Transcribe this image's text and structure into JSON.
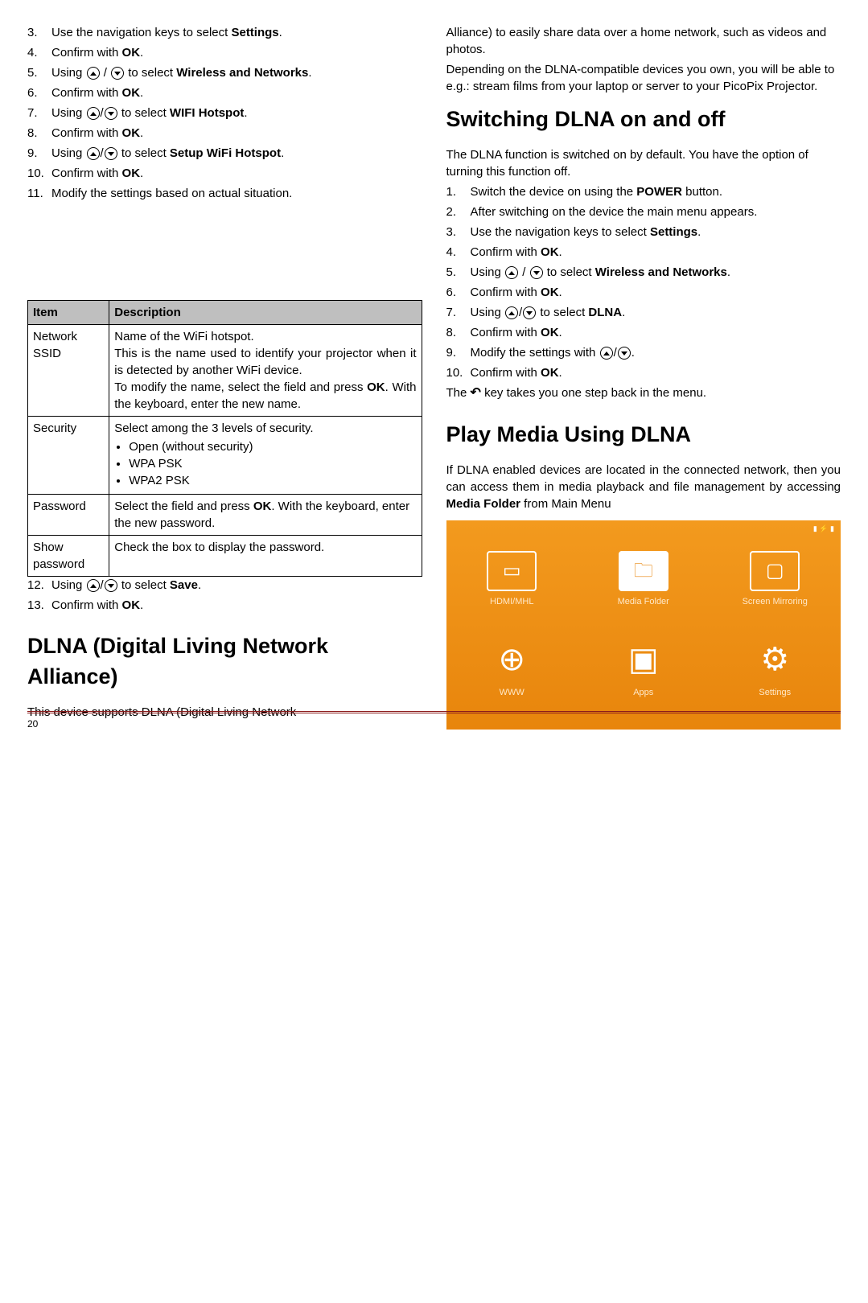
{
  "left": {
    "steps_a": [
      {
        "n": "3.",
        "t_pre": "Use the navigation keys to select ",
        "b": "Settings",
        "t_post": "."
      },
      {
        "n": "4.",
        "t_pre": "Confirm with ",
        "b": "OK",
        "t_post": "."
      },
      {
        "n": "5.",
        "t_pre": "Using ",
        "icons": "updown_spaced",
        "t_mid": " to select ",
        "b": "Wireless and Networks",
        "t_post": "."
      },
      {
        "n": "6.",
        "t_pre": "Confirm with ",
        "b": "OK",
        "t_post": "."
      },
      {
        "n": "7.",
        "t_pre": "Using ",
        "icons": "updown",
        "t_mid": " to select ",
        "b": "WIFI Hotspot",
        "t_post": "."
      },
      {
        "n": "8.",
        "t_pre": "Confirm with ",
        "b": "OK",
        "t_post": "."
      },
      {
        "n": "9.",
        "t_pre": "Using ",
        "icons": "updown",
        "t_mid": " to select ",
        "b": "Setup WiFi Hotspot",
        "t_post": "."
      },
      {
        "n": "10.",
        "t_pre": "Confirm with ",
        "b": "OK",
        "t_post": "."
      },
      {
        "n": "11.",
        "t_pre": "Modify the settings based on actual situation.",
        "b": "",
        "t_post": ""
      }
    ],
    "table": {
      "headers": [
        "Item",
        "Description"
      ],
      "rows": [
        {
          "item": "Network SSID",
          "desc": {
            "p1": "Name of the WiFi hotspot.",
            "p2": "This is the name used to identify your projector when it is detected by another WiFi device.",
            "p3_pre": "To modify the name, select the field and press ",
            "p3_b": "OK",
            "p3_post": ". With the keyboard, enter the new name."
          }
        },
        {
          "item": "Security",
          "desc": {
            "p1": "Select among the 3 levels of security.",
            "bullets": [
              "Open (without security)",
              "WPA PSK",
              "WPA2 PSK"
            ]
          }
        },
        {
          "item": "Password",
          "desc": {
            "p1_pre": "Select the field and press ",
            "p1_b": "OK",
            "p1_post": ". With the keyboard, enter the new password."
          }
        },
        {
          "item": "Show password",
          "desc": {
            "p1": "Check the box to display the password."
          }
        }
      ]
    },
    "steps_b": [
      {
        "n": "12.",
        "t_pre": "Using ",
        "icons": "updown",
        "t_mid": " to select ",
        "b": "Save",
        "t_post": "."
      },
      {
        "n": "13.",
        "t_pre": "Confirm with ",
        "b": "OK",
        "t_post": "."
      }
    ],
    "h_dlna": "DLNA (Digital Living Network Alliance)",
    "p_dlna": "This device supports DLNA (Digital Living Network"
  },
  "right": {
    "intro": "Alliance) to easily share data over a home network, such as videos and photos.",
    "intro2": "Depending on the DLNA-compatible devices you own, you will be able to e.g.: stream films from your laptop or server to your PicoPix Projector.",
    "h_switch": "Switching DLNA on and off",
    "switch_p": "The DLNA function is switched on by default. You have the option of turning this function off.",
    "steps": [
      {
        "n": "1.",
        "t_pre": "Switch the device on using the ",
        "b": "POWER",
        "t_post": " button."
      },
      {
        "n": "2.",
        "t_pre": "After switching on the device the main menu appears.",
        "b": "",
        "t_post": ""
      },
      {
        "n": "3.",
        "t_pre": "Use the navigation keys to select ",
        "b": "Settings",
        "t_post": "."
      },
      {
        "n": "4.",
        "t_pre": "Confirm with ",
        "b": "OK",
        "t_post": "."
      },
      {
        "n": "5.",
        "t_pre": "Using ",
        "icons": "updown_spaced",
        "t_mid": " to select ",
        "b": "Wireless and Networks",
        "t_post": "."
      },
      {
        "n": "6.",
        "t_pre": "Confirm with ",
        "b": "OK",
        "t_post": "."
      },
      {
        "n": "7.",
        "t_pre": "Using ",
        "icons": "updown",
        "t_mid": " to select ",
        "b": "DLNA",
        "t_post": "."
      },
      {
        "n": "8.",
        "t_pre": "Confirm with ",
        "b": "OK",
        "t_post": "."
      },
      {
        "n": "9.",
        "t_pre": "Modify the settings with ",
        "icons": "updown",
        "t_post": "."
      },
      {
        "n": "10.",
        "t_pre": "Confirm with ",
        "b": "OK",
        "t_post": "."
      }
    ],
    "back_note_pre": "The ",
    "back_note_post": " key takes you one step back in the menu.",
    "h_play": "Play Media Using DLNA",
    "play_p_pre": "If DLNA enabled devices are located in the connected network, then you can access them in media playback and file management by accessing ",
    "play_p_b": "Media Folder",
    "play_p_post": " from Main Menu",
    "menu": {
      "items": [
        {
          "label": "HDMI/MHL",
          "glyph": "▭"
        },
        {
          "label": "Media Folder",
          "glyph": "🗀",
          "selected": true
        },
        {
          "label": "Screen Mirroring",
          "glyph": "▢"
        },
        {
          "label": "WWW",
          "glyph": "⊕"
        },
        {
          "label": "Apps",
          "glyph": "▣"
        },
        {
          "label": "Settings",
          "glyph": "⚙"
        }
      ]
    }
  },
  "page": "20"
}
